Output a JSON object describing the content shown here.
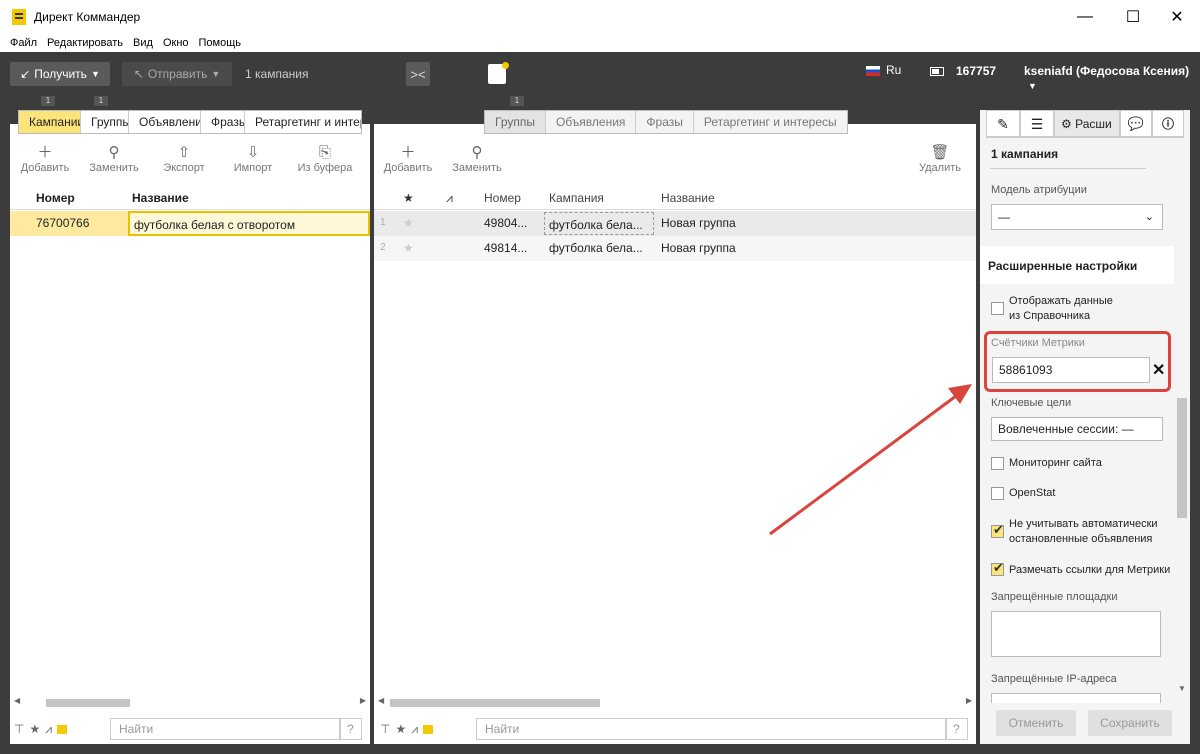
{
  "window": {
    "title": "Директ Коммандер",
    "min": "—",
    "max": "☐",
    "close": "✕"
  },
  "menu": [
    "Файл",
    "Редактировать",
    "Вид",
    "Окно",
    "Помощь"
  ],
  "toolbar": {
    "get": "Получить",
    "send": "Отправить",
    "campaigns": "1 кампания",
    "lang": "Ru",
    "balance": "167757",
    "user": "kseniafd (Федосова Ксения)"
  },
  "left": {
    "tabs": [
      "Кампании",
      "Группы",
      "Объявления",
      "Фразы",
      "Ретаргетинг и интересы"
    ],
    "tab_counts": [
      "1",
      "1"
    ],
    "tools": [
      "Добавить",
      "Заменить",
      "Экспорт",
      "Импорт",
      "Из буфера"
    ],
    "headers": [
      "Номер",
      "Название"
    ],
    "rows": [
      {
        "id": "76700766",
        "name": "футболка белая с отворотом"
      }
    ],
    "find": "Найти",
    "help": "?"
  },
  "middle": {
    "tabs": [
      "Группы",
      "Объявления",
      "Фразы",
      "Ретаргетинг и интересы"
    ],
    "tab_count": "1",
    "tools": [
      "Добавить",
      "Заменить",
      "Удалить"
    ],
    "headers": [
      "Номер",
      "Кампания",
      "Название"
    ],
    "rows": [
      {
        "n": "1",
        "id": "49804...",
        "camp": "футболка бела...",
        "name": "Новая группа"
      },
      {
        "n": "2",
        "id": "49814...",
        "camp": "футболка бела...",
        "name": "Новая группа"
      }
    ],
    "find": "Найти",
    "help": "?"
  },
  "right": {
    "tab_settings": "Расши",
    "campaign": "1 кампания",
    "attribution_label": "Модель атрибуции",
    "attribution_value": "—",
    "advanced_title": "Расширенные настройки",
    "show_directory_1": "Отображать данные",
    "show_directory_2": "из Справочника",
    "metrika_label": "Счётчики Метрики",
    "metrika_value": "58861093",
    "key_goals_label": "Ключевые цели",
    "key_goals_value": "Вовлеченные сессии: —",
    "monitoring": "Мониторинг сайта",
    "openstat": "OpenStat",
    "ignore_auto_1": "Не учитывать автоматически",
    "ignore_auto_2": "остановленные объявления",
    "mark_links": "Размечать ссылки для Метрики",
    "forbidden_sites": "Запрещённые площадки",
    "forbidden_ip": "Запрещённые IP-адреса",
    "cancel": "Отменить",
    "save": "Сохранить"
  },
  "colors": {
    "accent": "#fde47a",
    "highlight": "#d9453c"
  }
}
